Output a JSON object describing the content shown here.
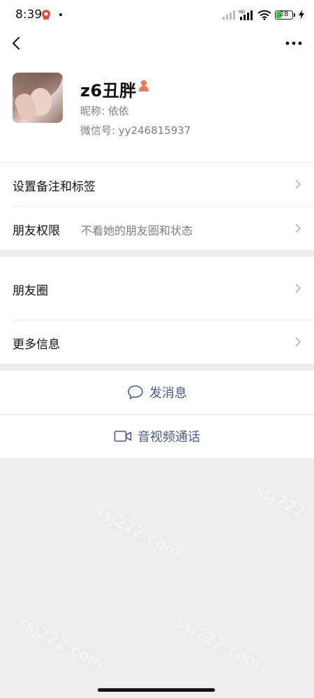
{
  "status_bar": {
    "time": "8:39",
    "battery_level": "28",
    "battery_fraction": 0.28,
    "network_label": "HD"
  },
  "profile": {
    "name": "z6丑胖",
    "nickname": "昵称: 依依",
    "wechat_id": "微信号: yy246815937"
  },
  "rows": {
    "remark": {
      "label": "设置备注和标签"
    },
    "permissions": {
      "label": "朋友权限",
      "value": "不看她的朋友圈和状态"
    },
    "moments": {
      "label": "朋友圈"
    },
    "more_info": {
      "label": "更多信息"
    }
  },
  "actions": {
    "message": "发消息",
    "video_call": "音视频通话"
  },
  "watermark": "ssj222.com",
  "colors": {
    "accent": "#4a5d86",
    "background": "#ededed",
    "gender_icon": "#e57a5e",
    "battery_fill": "#31c14b"
  },
  "icons": [
    "back-arrow-icon",
    "more-dots-icon",
    "female-gender-icon",
    "chevron-right-icon",
    "chat-bubble-icon",
    "video-camera-icon"
  ]
}
